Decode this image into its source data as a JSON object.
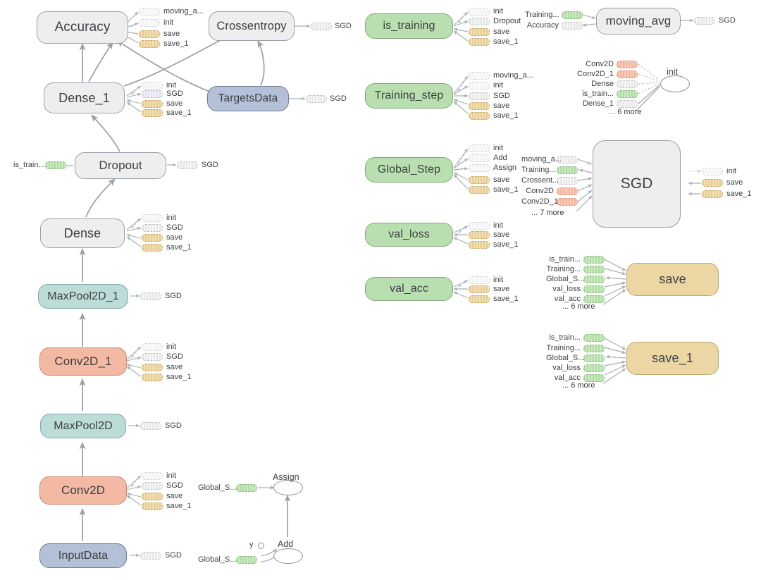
{
  "graph": {
    "title": "TensorFlow computation graph",
    "background": "#ffffff",
    "colors": {
      "grey": "#eeeeee",
      "blue": "#b4c0d8",
      "teal": "#bcdcd8",
      "salmon": "#f4b9a3",
      "green": "#b9dfb0",
      "tan": "#ecd6a4",
      "edge": "#9aa0a6",
      "text": "#3c4043"
    }
  },
  "nodes": {
    "accuracy": {
      "label": "Accuracy",
      "type": "namespace",
      "color": "grey"
    },
    "crossentropy": {
      "label": "Crossentropy",
      "type": "namespace",
      "color": "grey"
    },
    "dense_1": {
      "label": "Dense_1",
      "type": "namespace",
      "color": "grey"
    },
    "targetsdata": {
      "label": "TargetsData",
      "type": "namespace",
      "color": "blue"
    },
    "dropout": {
      "label": "Dropout",
      "type": "namespace",
      "color": "grey"
    },
    "dense": {
      "label": "Dense",
      "type": "namespace",
      "color": "grey"
    },
    "maxpool2d_1": {
      "label": "MaxPool2D_1",
      "type": "namespace",
      "color": "teal"
    },
    "conv2d_1": {
      "label": "Conv2D_1",
      "type": "namespace",
      "color": "salmon"
    },
    "maxpool2d": {
      "label": "MaxPool2D",
      "type": "namespace",
      "color": "teal"
    },
    "conv2d": {
      "label": "Conv2D",
      "type": "namespace",
      "color": "salmon"
    },
    "inputdata": {
      "label": "InputData",
      "type": "namespace",
      "color": "blue"
    },
    "is_training": {
      "label": "is_training",
      "type": "namespace",
      "color": "green"
    },
    "training_step": {
      "label": "Training_step",
      "type": "namespace",
      "color": "green"
    },
    "global_step": {
      "label": "Global_Step",
      "type": "namespace",
      "color": "green"
    },
    "val_loss": {
      "label": "val_loss",
      "type": "namespace",
      "color": "green"
    },
    "val_acc": {
      "label": "val_acc",
      "type": "namespace",
      "color": "green"
    },
    "moving_avg": {
      "label": "moving_avg",
      "type": "namespace",
      "color": "grey"
    },
    "sgd": {
      "label": "SGD",
      "type": "group",
      "color": "grey"
    },
    "save": {
      "label": "save",
      "type": "namespace",
      "color": "tan"
    },
    "save_1": {
      "label": "save_1",
      "type": "namespace",
      "color": "tan"
    },
    "init_op": {
      "label": "init",
      "type": "op"
    },
    "assign_op": {
      "label": "Assign",
      "type": "op"
    },
    "add_op": {
      "label": "Add",
      "type": "op"
    },
    "y_const": {
      "label": "y",
      "type": "const"
    }
  },
  "annotations": {
    "accuracy_out": [
      "moving_a...",
      "init",
      "save",
      "save_1"
    ],
    "crossentropy_out": [
      "SGD"
    ],
    "dense_1_out": [
      "init",
      "SGD",
      "save",
      "save_1"
    ],
    "targetsdata_out": [
      "SGD"
    ],
    "dropout_in": [
      "is_train..."
    ],
    "dropout_out": [
      "SGD"
    ],
    "dense_out": [
      "init",
      "SGD",
      "save",
      "save_1"
    ],
    "maxpool2d_1_out": [
      "SGD"
    ],
    "conv2d_1_out": [
      "init",
      "SGD",
      "save",
      "save_1"
    ],
    "maxpool2d_out": [
      "SGD"
    ],
    "conv2d_out": [
      "init",
      "SGD",
      "save",
      "save_1"
    ],
    "inputdata_out": [
      "SGD"
    ],
    "is_training_out": [
      "init",
      "Dropout",
      "save",
      "save_1"
    ],
    "training_step_out": [
      "moving_a...",
      "init",
      "SGD",
      "save",
      "save_1"
    ],
    "global_step_out": [
      "init",
      "Add",
      "Assign",
      "save",
      "save_1"
    ],
    "val_loss_out": [
      "init",
      "save",
      "save_1"
    ],
    "val_acc_out": [
      "init",
      "save",
      "save_1"
    ],
    "moving_avg_in": [
      "Training...",
      "Accuracy"
    ],
    "moving_avg_out": [
      "SGD"
    ],
    "init_in": [
      "Conv2D",
      "Conv2D_1",
      "Dense",
      "is_train...",
      "Dense_1"
    ],
    "init_in_more": "... 6 more",
    "sgd_in": [
      "moving_a...",
      "Training...",
      "Crossent...",
      "Conv2D",
      "Conv2D_1"
    ],
    "sgd_in_more": "... 7 more",
    "sgd_out": [
      "init",
      "save",
      "save_1"
    ],
    "save_in": [
      "is_train...",
      "Training...",
      "Global_S...",
      "val_loss",
      "val_acc"
    ],
    "save_in_more": "... 6 more",
    "save_1_in": [
      "is_train...",
      "Training...",
      "Global_S...",
      "val_loss",
      "val_acc"
    ],
    "save_1_in_more": "... 6 more",
    "assign_in": [
      "Global_S..."
    ],
    "add_in": [
      "Global_S..."
    ]
  }
}
